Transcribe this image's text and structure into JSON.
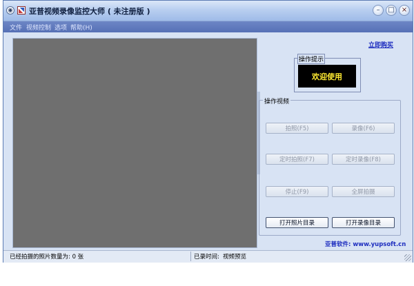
{
  "window": {
    "title": "亚普视频录像监控大师 ( 未注册版 )",
    "icons": {
      "system": "system-menu-icon",
      "app": "app-logo-icon"
    },
    "controls": {
      "minimize_glyph": "–",
      "maximize_glyph": "□",
      "close_glyph": "×"
    }
  },
  "menu": {
    "items": [
      "文件",
      "视频控制",
      "选项",
      "帮助(H)"
    ]
  },
  "buy_link": "立即购买",
  "hint": {
    "label": "操作提示",
    "message": "欢迎使用"
  },
  "operations": {
    "label": "操作视频",
    "buttons": [
      {
        "label": "拍照(F5)",
        "enabled": false
      },
      {
        "label": "录像(F6)",
        "enabled": false
      },
      {
        "label": "定时拍照(F7)",
        "enabled": false
      },
      {
        "label": "定时录像(F8)",
        "enabled": false
      },
      {
        "label": "停止(F9)",
        "enabled": false
      },
      {
        "label": "全屏拍摄",
        "enabled": false
      },
      {
        "label": "打开照片目录",
        "enabled": true
      },
      {
        "label": "打开录像目录",
        "enabled": true
      }
    ]
  },
  "company": "亚普软件: www.yupsoft.cn",
  "status": {
    "photo_count_label": "已经拍摄的照片数量为: 0 张",
    "record_time_label": "已录时间:",
    "record_time_value": "视频预览"
  },
  "colors": {
    "title_gradient_top": "#dbe7f8",
    "menubar": "#5670b6",
    "video_bg": "#6f6f6f",
    "hint_text": "#ffeb32",
    "link": "#1d2dbf"
  }
}
